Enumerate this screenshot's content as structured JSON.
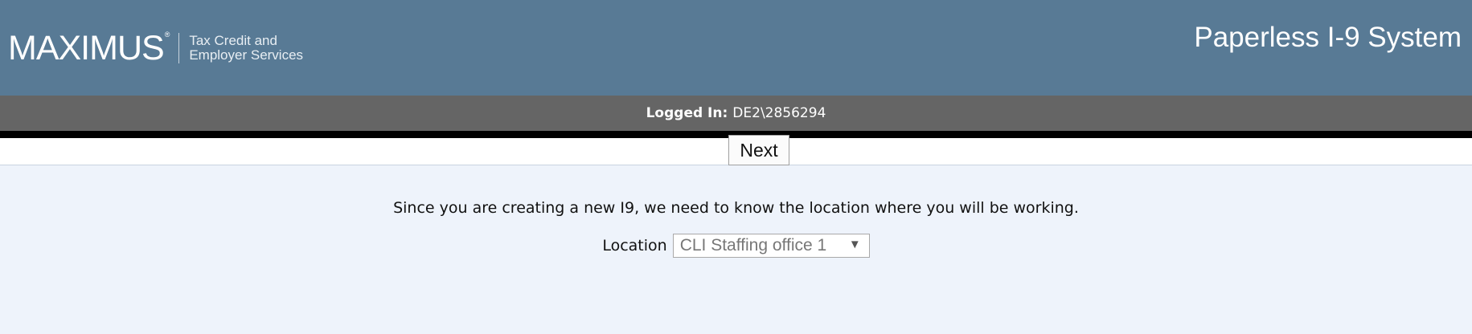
{
  "header": {
    "logo_word": "MAXIMUS",
    "logo_reg": "®",
    "logo_tagline_1": "Tax Credit and",
    "logo_tagline_2": "Employer Services",
    "app_title": "Paperless I-9 System"
  },
  "login": {
    "label": "Logged In:",
    "user": "DE2\\2856294"
  },
  "main": {
    "prompt": "Since you are creating a new I9, we need to know the location where you will be working.",
    "location_label": "Location",
    "location_selected": "CLI Staffing office 1",
    "next_label": "Next"
  },
  "icons": {
    "dropdown": "chevron-down-icon"
  },
  "colors": {
    "header_bg": "#587a95",
    "login_bar_bg": "#656565",
    "content_bg": "#eef3fb"
  }
}
